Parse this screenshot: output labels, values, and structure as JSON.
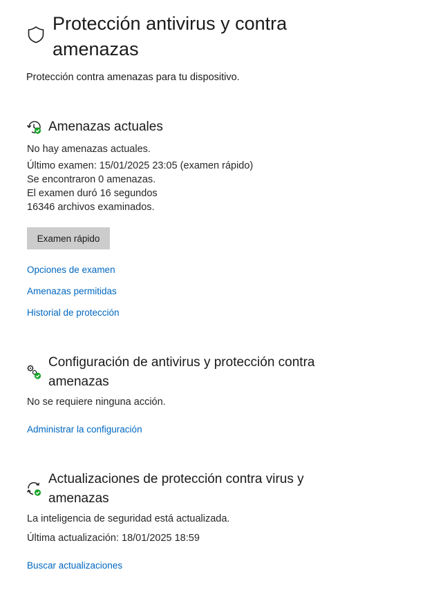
{
  "header": {
    "title": "Protección antivirus y contra amenazas",
    "subtitle": "Protección contra amenazas para tu dispositivo.",
    "icon": "shield-icon"
  },
  "current_threats": {
    "icon": "history-check-icon",
    "title": "Amenazas actuales",
    "lines": [
      "No hay amenazas actuales.",
      "Último examen: 15/01/2025 23:05 (examen rápido)",
      "Se encontraron 0 amenazas.",
      "El examen duró 16 segundos",
      "16346 archivos examinados."
    ],
    "button": "Examen rápido",
    "links": [
      "Opciones de examen",
      "Amenazas permitidas",
      "Historial de protección"
    ]
  },
  "settings": {
    "icon": "gears-check-icon",
    "title": "Configuración de antivirus y protección contra amenazas",
    "status": "No se requiere ninguna acción.",
    "link": "Administrar la configuración"
  },
  "updates": {
    "icon": "refresh-check-icon",
    "title": "Actualizaciones de protección contra virus y amenazas",
    "lines": [
      "La inteligencia de seguridad está actualizada.",
      "Última actualización: 18/01/2025 18:59"
    ],
    "link": "Buscar actualizaciones"
  },
  "colors": {
    "link": "#0067c0",
    "button_bg": "#cccccc",
    "check_green": "#16a326"
  }
}
